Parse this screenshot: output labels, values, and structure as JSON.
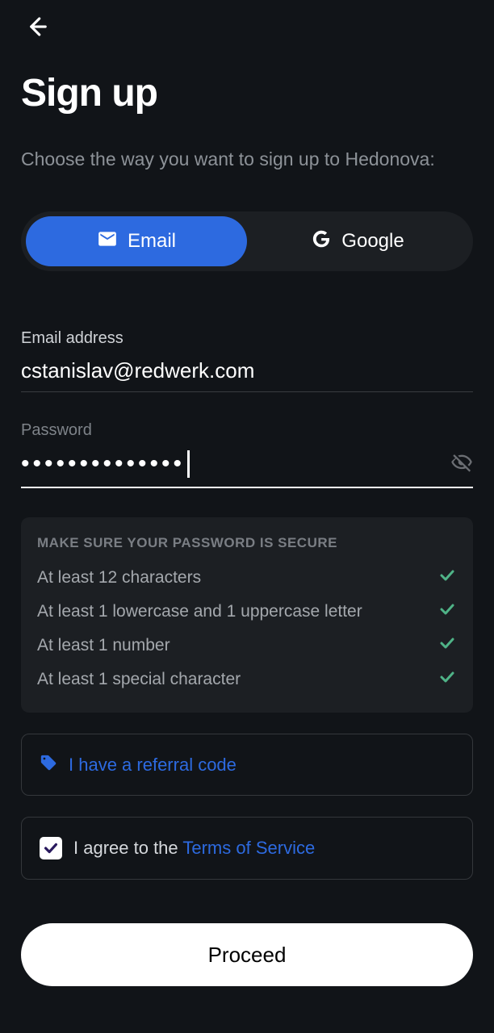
{
  "title": "Sign up",
  "subtitle": "Choose the way you want to sign up to Hedonova:",
  "methods": {
    "email": "Email",
    "google": "Google"
  },
  "email": {
    "label": "Email address",
    "value": "cstanislav@redwerk.com"
  },
  "password": {
    "label": "Password",
    "value_mask": "••••••••••••••"
  },
  "checklist": {
    "title": "MAKE SURE YOUR PASSWORD IS SECURE",
    "items": [
      {
        "text": "At least 12 characters",
        "ok": true
      },
      {
        "text": "At least 1 lowercase and 1 uppercase letter",
        "ok": true
      },
      {
        "text": "At least 1 number",
        "ok": true
      },
      {
        "text": "At least 1 special character",
        "ok": true
      }
    ]
  },
  "referral": {
    "text": "I have a referral code"
  },
  "terms": {
    "prefix": "I agree to the ",
    "link": "Terms of Service",
    "checked": true
  },
  "proceed": "Proceed",
  "colors": {
    "accent": "#2d6ae0",
    "success": "#4fb387"
  }
}
